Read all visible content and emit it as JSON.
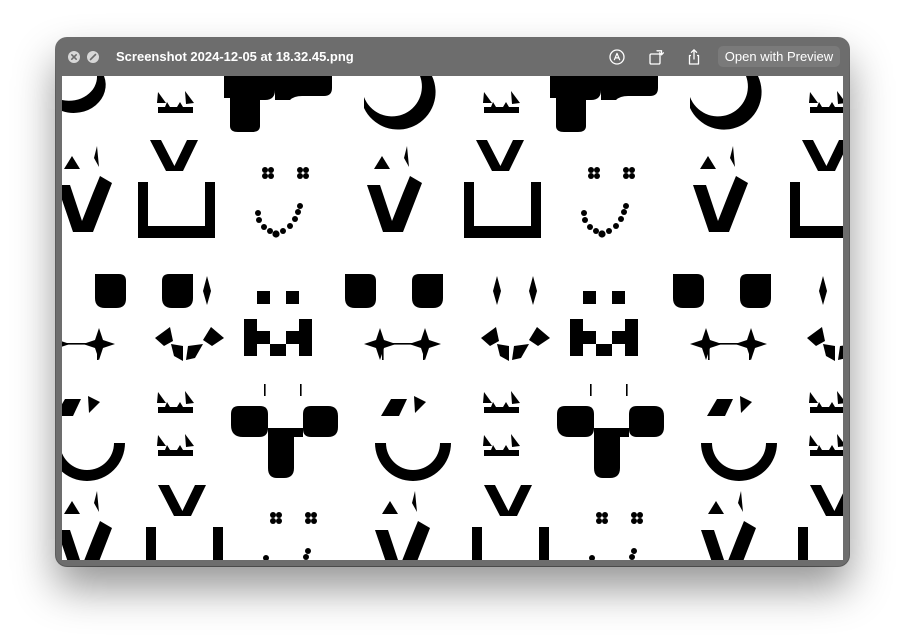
{
  "window": {
    "title": "Screenshot 2024-12-05 at 18.32.45.png",
    "open_with_label": "Open with Preview"
  },
  "toolbar_icons": [
    "close-icon",
    "fullscreen-icon",
    "markup-icon",
    "rotate-icon",
    "share-icon",
    "live-text-icon"
  ],
  "colors": {
    "titlebar": "#6d6d6d",
    "canvas": "#ffffff",
    "glyphs": "#000000"
  },
  "image": {
    "description_icons": [
      "smiley-pattern"
    ]
  }
}
